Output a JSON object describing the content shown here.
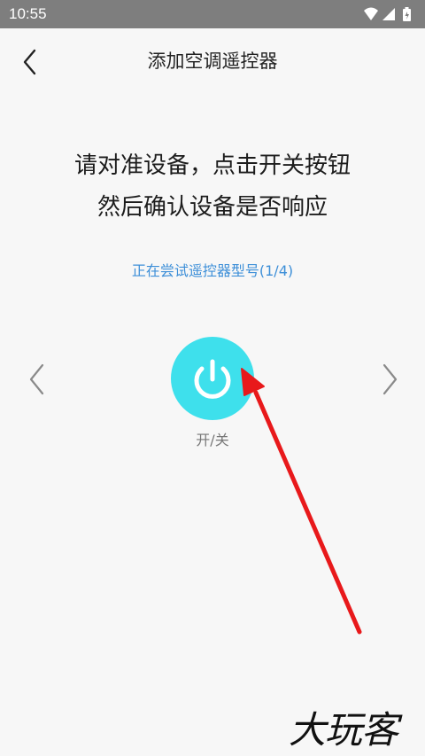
{
  "status_bar": {
    "time": "10:55",
    "icons": [
      "wifi-icon",
      "signal-icon",
      "battery-icon"
    ]
  },
  "header": {
    "back_icon": "chevron-left-icon",
    "title": "添加空调遥控器"
  },
  "instructions": {
    "line1": "请对准设备，点击开关按钮",
    "line2": "然后确认设备是否响应"
  },
  "trying_text": "正在尝试遥控器型号(1/4)",
  "remote": {
    "power_icon": "power-icon",
    "power_label": "开/关",
    "prev_icon": "chevron-left-icon",
    "next_icon": "chevron-right-icon"
  },
  "watermark": "大玩客",
  "colors": {
    "status_bar": "#7e7e7e",
    "background": "#f7f7f7",
    "accent_link": "#3d8fd8",
    "power_button": "#3ee0ec",
    "annotation_arrow": "#e8191b"
  }
}
